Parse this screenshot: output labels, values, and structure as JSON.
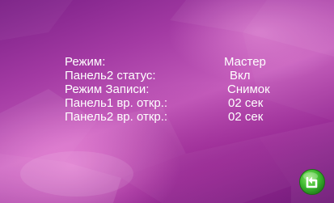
{
  "settings": {
    "rows": [
      {
        "label": "Режим:",
        "value": "Мастер"
      },
      {
        "label": "Панель2 статус:",
        "value": "Вкл"
      },
      {
        "label": "Режим Записи:",
        "value": "Снимок"
      },
      {
        "label": "Панель1 вр. откр.:",
        "value": "02 сек"
      },
      {
        "label": "Панель2 вр. откр.:",
        "value": "02 сек"
      }
    ]
  },
  "back_button": {
    "icon": "return-arrow-icon",
    "color": "#3cb82e"
  },
  "colors": {
    "text": "#ffffff",
    "background_primary": "#a33aa3",
    "background_dark": "#6f1a78",
    "accent_green": "#3cb82e"
  }
}
